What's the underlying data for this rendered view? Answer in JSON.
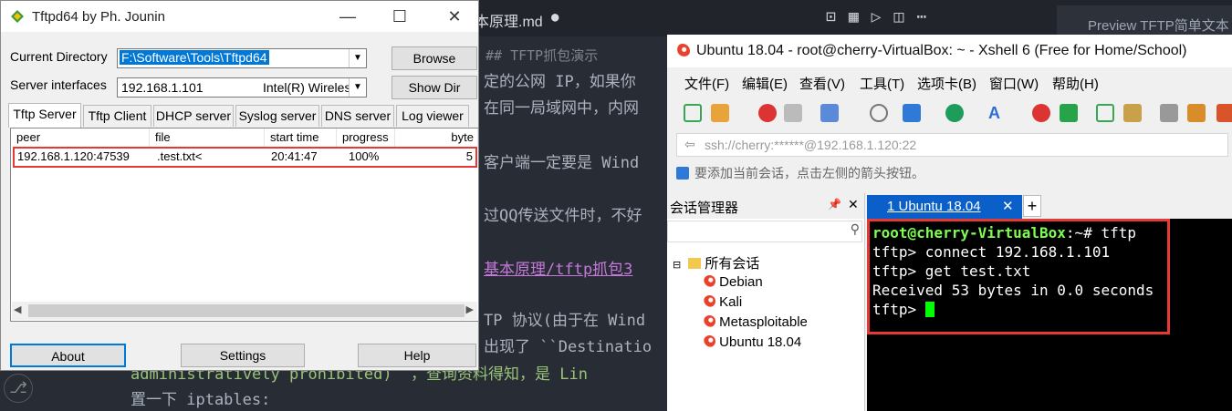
{
  "editor": {
    "tab_title": "本原理.md",
    "tab_modified": "●",
    "preview_tab": "Preview TFTP简单文本",
    "lines": [
      "## TFTP抓包演示",
      "定的公网 IP，如果你",
      "在同一局域网中，内网",
      "客户端一定要是 Wind",
      "过QQ传送文件时，不好",
      "基本原理/tftp抓包3",
      "TP 协议(由于在 Wind",
      "出现了 ``Destinatio",
      "administratively prohibited)``，查询资料得知，是 Lin",
      "置一下 iptables:"
    ]
  },
  "tftpd": {
    "title": "Tftpd64 by Ph. Jounin",
    "current_directory_label": "Current Directory",
    "current_directory_value": "F:\\Software\\Tools\\Tftpd64",
    "server_interfaces_label": "Server interfaces",
    "server_ip": "192.168.1.101",
    "server_adapter": "Intel(R) Wireless",
    "browse_label": "Browse",
    "showdir_label": "Show Dir",
    "tabs": [
      "Tftp Server",
      "Tftp Client",
      "DHCP server",
      "Syslog server",
      "DNS server",
      "Log viewer"
    ],
    "columns": [
      "peer",
      "file",
      "start time",
      "progress",
      "byte"
    ],
    "rows": [
      {
        "peer": "192.168.1.120:47539",
        "file": ".test.txt<",
        "start_time": "20:41:47",
        "progress": "100%",
        "bytes": "5"
      }
    ],
    "about_label": "About",
    "settings_label": "Settings",
    "help_label": "Help"
  },
  "xshell": {
    "title": "Ubuntu 18.04 - root@cherry-VirtualBox: ~ - Xshell 6 (Free for Home/School)",
    "menu": [
      "文件(F)",
      "编辑(E)",
      "查看(V)",
      "工具(T)",
      "选项卡(B)",
      "窗口(W)",
      "帮助(H)"
    ],
    "address": "ssh://cherry:******@192.168.1.120:22",
    "hint": "要添加当前会话，点击左侧的箭头按钮。",
    "session_manager_title": "会话管理器",
    "pin_glyph": "📌",
    "tree_root": "所有会话",
    "sessions": [
      "Debian",
      "Kali",
      "Metasploitable",
      "Ubuntu 18.04"
    ],
    "active_tab": "1 Ubuntu 18.04",
    "terminal": {
      "prompt_user": "root@cherry-VirtualBox",
      "prompt_rest": ":~# tftp",
      "line2": "tftp> connect 192.168.1.101",
      "line3": "tftp> get test.txt",
      "line4": "Received 53 bytes in 0.0 seconds",
      "line5": "tftp> "
    }
  }
}
